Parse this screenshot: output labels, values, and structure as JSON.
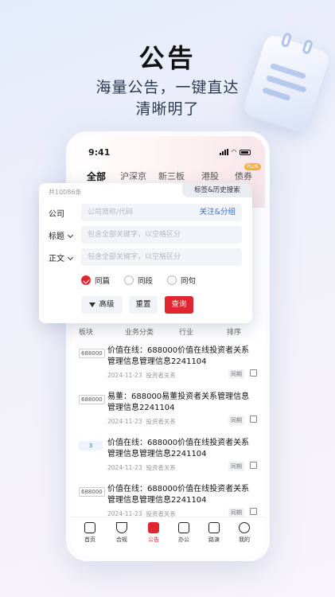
{
  "hero": {
    "title": "公告",
    "subtitle_line1": "海量公告，一键直达",
    "subtitle_line2": "清晰明了"
  },
  "status_bar": {
    "time": "9:41"
  },
  "tabs": [
    {
      "label": "全部",
      "active": true
    },
    {
      "label": "沪深京",
      "active": false
    },
    {
      "label": "新三板",
      "active": false
    },
    {
      "label": "港股",
      "active": false
    },
    {
      "label": "债券",
      "active": false,
      "badge": "PLUS"
    }
  ],
  "search_panel": {
    "count_text": "共10086条",
    "history_button": "标签&历史搜索",
    "company_label": "公司",
    "company_placeholder": "公司简称/代码",
    "follow_group_link": "关注&分组",
    "title_label": "标题",
    "title_placeholder": "包含全部关键字，以空格区分",
    "body_label": "正文",
    "body_placeholder": "包含全部关键字，以空格区分",
    "scope_options": [
      {
        "label": "同篇",
        "selected": true
      },
      {
        "label": "同段",
        "selected": false
      },
      {
        "label": "同句",
        "selected": false
      }
    ],
    "advanced_button": "高级",
    "reset_button": "重置",
    "query_button": "查询"
  },
  "filter_bar": {
    "plate": "板块",
    "business": "业务分类",
    "industry": "行业",
    "sort": "排序"
  },
  "announcements": [
    {
      "code": "688000",
      "title": "价值在线：688000价值在线投资者关系管理信息管理信息2241104",
      "date": "2024-11-23",
      "category": "投资者关系",
      "tag": "同期"
    },
    {
      "code": "688000",
      "title": "易董：688000易董投资者关系管理信息管理信息2241104",
      "date": "2024-11-23",
      "category": "投资者关系",
      "tag": "同期"
    },
    {
      "code": "3",
      "title": "价值在线：688000价值在线投资者关系管理信息管理信息2241104",
      "date": "2024-11-23",
      "category": "投资者关系",
      "tag": "同期"
    },
    {
      "code": "688000",
      "title": "价值在线：688000价值在线投资者关系管理信息管理信息2241104",
      "date": "2024-11-23",
      "category": "投资者关系",
      "tag": "同期"
    }
  ],
  "bottom_nav": [
    {
      "label": "首页",
      "icon": "home-icon",
      "active": false
    },
    {
      "label": "合规",
      "icon": "shield-icon",
      "active": false
    },
    {
      "label": "公告",
      "icon": "announcement-icon",
      "active": true
    },
    {
      "label": "办公",
      "icon": "briefcase-icon",
      "active": false
    },
    {
      "label": "路演",
      "icon": "video-icon",
      "active": false
    },
    {
      "label": "我的",
      "icon": "profile-icon",
      "active": false
    }
  ],
  "colors": {
    "accent_red": "#e0262f",
    "link_blue": "#3a6fd8",
    "badge_orange": "#f2b13a"
  }
}
